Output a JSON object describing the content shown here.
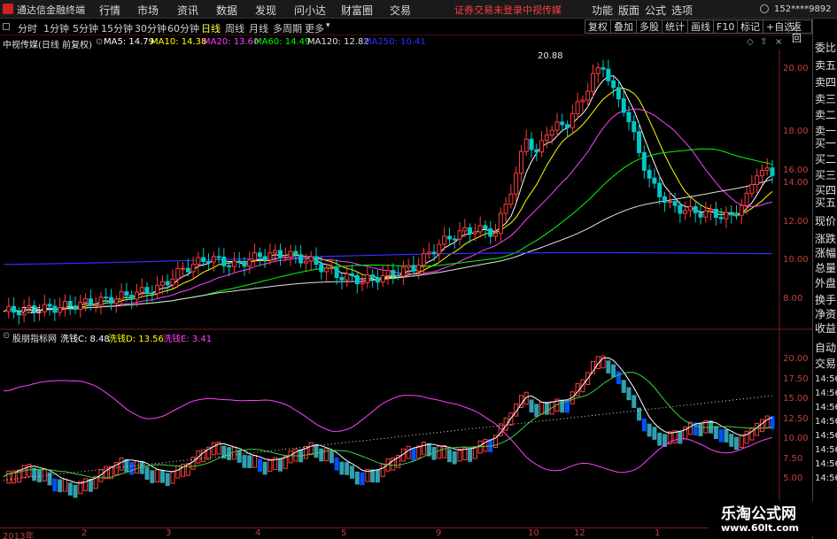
{
  "topbar": {
    "app_title": "通达信金融终端",
    "menus": [
      "行情",
      "市场",
      "资讯",
      "数据",
      "发现",
      "问小达",
      "财富圈",
      "交易"
    ],
    "notice": "证券交易未登录",
    "stock_notice": "中视传媒",
    "right_menus": [
      "功能",
      "版面",
      "公式",
      "选项"
    ],
    "account": "152****9892"
  },
  "toolbar": {
    "periods": [
      "分时",
      "1分钟",
      "5分钟",
      "15分钟",
      "30分钟",
      "60分钟",
      "日线",
      "周线",
      "月线",
      "多周期",
      "更多"
    ],
    "active_period": "日线",
    "buttons": [
      "复权",
      "叠加",
      "多股",
      "统计",
      "画线",
      "F10",
      "标记",
      "+自选",
      "返回"
    ]
  },
  "main_chart": {
    "title": "中视传媒(日线 前复权)",
    "ma": [
      {
        "label": "MA5: 14.79",
        "color": "#ffffff"
      },
      {
        "label": "MA10: 14.38",
        "color": "#ffff00"
      },
      {
        "label": "MA20: 13.60",
        "color": "#ff40ff"
      },
      {
        "label": "MA60: 14.49",
        "color": "#00ff00"
      },
      {
        "label": "MA120: 12.82",
        "color": "#e0e0e0"
      },
      {
        "label": "MA250: 10.41",
        "color": "#3030ff"
      }
    ],
    "y_ticks": [
      "20.00",
      "18.00",
      "16.00",
      "14.00",
      "12.00",
      "10.00",
      "8.00"
    ],
    "high_label": "20.88",
    "low_label": "7.26"
  },
  "indicator": {
    "name": "股朋指标网",
    "lines": [
      {
        "label": "洗钱C: 8.48",
        "color": "#ffffff"
      },
      {
        "label": "洗钱D: 13.56",
        "color": "#ffff00"
      },
      {
        "label": "洗钱E: 3.41",
        "color": "#ff40ff"
      }
    ],
    "y_ticks": [
      "20.00",
      "17.50",
      "15.00",
      "12.50",
      "10.00",
      "7.50",
      "5.00"
    ]
  },
  "time_axis": [
    "2013年",
    "2",
    "3",
    "4",
    "5",
    "9",
    "10",
    "12",
    "1"
  ],
  "right_panel": {
    "labels": [
      "委比",
      "卖五",
      "卖四",
      "卖三",
      "卖二",
      "卖一",
      "买一",
      "买二",
      "买三",
      "买四",
      "买五",
      "现价",
      "涨跌",
      "涨幅",
      "总量",
      "外盘",
      "换手",
      "净资",
      "收益"
    ],
    "bottom_labels": [
      "自动",
      "交易"
    ],
    "times": [
      "14:56",
      "14:56",
      "14:56",
      "14:56",
      "14:56",
      "14:56",
      "14:56",
      "14:56"
    ]
  },
  "watermark": {
    "line1": "乐淘公式网",
    "line2": "www.60lt.com"
  },
  "colors": {
    "up": "#ff3c3c",
    "down": "#00c8c8",
    "axis": "#c04040"
  }
}
